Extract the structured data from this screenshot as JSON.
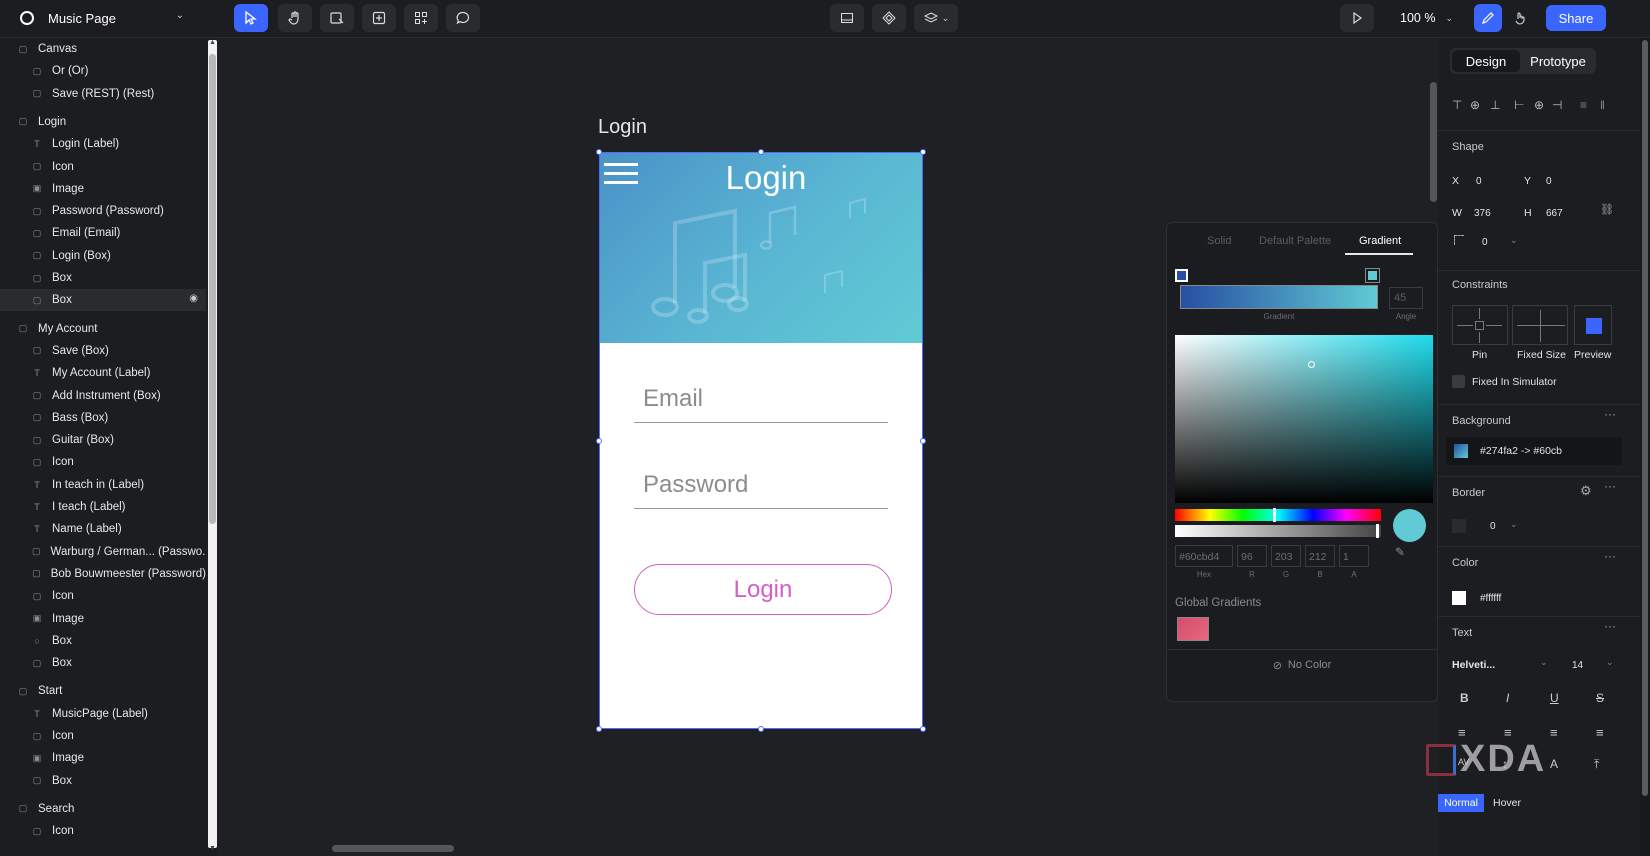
{
  "app": {
    "project_title": "Music Page",
    "zoom": "100 %",
    "share_label": "Share"
  },
  "layers": [
    {
      "label": "Canvas",
      "indent": 0,
      "type": "group"
    },
    {
      "label": "Or (Or)",
      "indent": 1,
      "type": "box"
    },
    {
      "label": "Save (REST) (Rest)",
      "indent": 1,
      "type": "box"
    },
    {
      "label": "Login",
      "indent": 0,
      "type": "group"
    },
    {
      "label": "Login (Label)",
      "indent": 1,
      "type": "text"
    },
    {
      "label": "Icon",
      "indent": 1,
      "type": "box"
    },
    {
      "label": "Image",
      "indent": 1,
      "type": "image"
    },
    {
      "label": "Password (Password)",
      "indent": 1,
      "type": "box"
    },
    {
      "label": "Email (Email)",
      "indent": 1,
      "type": "box"
    },
    {
      "label": "Login (Box)",
      "indent": 1,
      "type": "box"
    },
    {
      "label": "Box",
      "indent": 1,
      "type": "box"
    },
    {
      "label": "Box",
      "indent": 1,
      "type": "box",
      "selected": true
    },
    {
      "label": "My Account",
      "indent": 0,
      "type": "group"
    },
    {
      "label": "Save (Box)",
      "indent": 1,
      "type": "box"
    },
    {
      "label": "My Account (Label)",
      "indent": 1,
      "type": "text"
    },
    {
      "label": "Add Instrument (Box)",
      "indent": 1,
      "type": "box"
    },
    {
      "label": "Bass (Box)",
      "indent": 1,
      "type": "box"
    },
    {
      "label": "Guitar (Box)",
      "indent": 1,
      "type": "box"
    },
    {
      "label": "Icon",
      "indent": 1,
      "type": "box"
    },
    {
      "label": "In teach in (Label)",
      "indent": 1,
      "type": "text"
    },
    {
      "label": "I teach (Label)",
      "indent": 1,
      "type": "text"
    },
    {
      "label": "Name (Label)",
      "indent": 1,
      "type": "text"
    },
    {
      "label": "Warburg / German... (Passwo...",
      "indent": 1,
      "type": "box"
    },
    {
      "label": "Bob Bouwmeester (Password)",
      "indent": 1,
      "type": "box"
    },
    {
      "label": "Icon",
      "indent": 1,
      "type": "box"
    },
    {
      "label": "Image",
      "indent": 1,
      "type": "image"
    },
    {
      "label": "Box",
      "indent": 1,
      "type": "circle"
    },
    {
      "label": "Box",
      "indent": 1,
      "type": "box"
    },
    {
      "label": "Start",
      "indent": 0,
      "type": "group"
    },
    {
      "label": "MusicPage (Label)",
      "indent": 1,
      "type": "text"
    },
    {
      "label": "Icon",
      "indent": 1,
      "type": "box"
    },
    {
      "label": "Image",
      "indent": 1,
      "type": "image"
    },
    {
      "label": "Box",
      "indent": 1,
      "type": "box"
    },
    {
      "label": "Search",
      "indent": 0,
      "type": "group"
    },
    {
      "label": "Icon",
      "indent": 1,
      "type": "box"
    }
  ],
  "artboard": {
    "name": "Login",
    "header_title": "Login",
    "email_placeholder": "Email",
    "password_placeholder": "Password",
    "login_button": "Login",
    "gradient_start": "#274fa2",
    "gradient_end": "#60cbd4",
    "button_color": "#d35fc8"
  },
  "picker": {
    "tabs": [
      "Solid",
      "Default Palette",
      "Gradient"
    ],
    "active_tab": "Gradient",
    "gradient_label": "Gradient",
    "angle_value": "45",
    "angle_label": "Angle",
    "hex": "#60cbd4",
    "r": "96",
    "g": "203",
    "b": "212",
    "a": "1",
    "hex_label": "Hex",
    "r_label": "R",
    "g_label": "G",
    "b_label": "B",
    "a_label": "A",
    "global_gradients_label": "Global Gradients",
    "no_color_label": "No Color"
  },
  "right": {
    "tab_design": "Design",
    "tab_prototype": "Prototype",
    "shape_title": "Shape",
    "x_label": "X",
    "x_value": "0",
    "y_label": "Y",
    "y_value": "0",
    "w_label": "W",
    "w_value": "376",
    "h_label": "H",
    "h_value": "667",
    "radius_value": "0",
    "constraints_title": "Constraints",
    "pin_label": "Pin",
    "fixed_size_label": "Fixed Size",
    "preview_label": "Preview",
    "fixed_sim_label": "Fixed In Simulator",
    "background_title": "Background",
    "background_value": "#274fa2 -> #60cb",
    "border_title": "Border",
    "border_value": "0",
    "color_title": "Color",
    "color_value": "#ffffff",
    "text_title": "Text",
    "font_value": "Helveti...",
    "font_size": "14",
    "state_normal": "Normal",
    "state_hover": "Hover"
  },
  "watermark": "XDA"
}
